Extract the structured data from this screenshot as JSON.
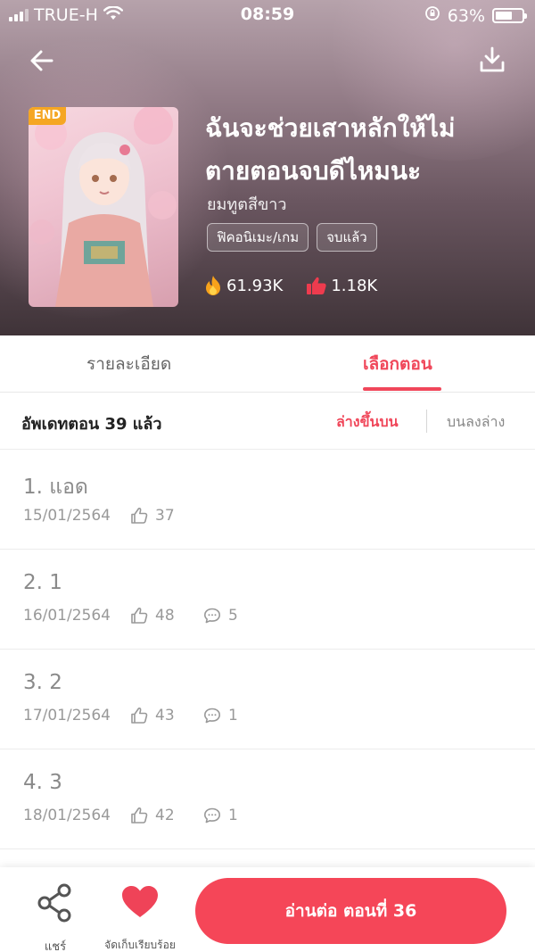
{
  "status_bar": {
    "carrier": "TRUE-H",
    "time": "08:59",
    "battery": "63%",
    "battery_level": 0.63,
    "wifi_icon": "wifi-icon",
    "lock_icon": "orientation-lock-icon"
  },
  "header": {
    "back_icon": "back-arrow-icon",
    "download_icon": "download-icon"
  },
  "book": {
    "badge": "END",
    "title_line1": "ฉันจะช่วยเสาหลักให้ไม่",
    "title_line2": "ตายตอนจบดีไหมนะ",
    "author": "ยมทูตสีขาว",
    "tags": [
      "ฟิคอนิเมะ/เกม",
      "จบแล้ว"
    ],
    "views": "61.93K",
    "likes": "1.18K",
    "views_icon": "fire-icon",
    "likes_icon": "thumbs-up-icon"
  },
  "tabs": [
    {
      "label": "รายละเอียด",
      "active": false
    },
    {
      "label": "เลือกตอน",
      "active": true
    }
  ],
  "episode_header": {
    "update_text": "อัพเดทตอน 39 แล้ว",
    "sort_asc": "ล่างขึ้นบน",
    "sort_desc": "บนลงล่าง"
  },
  "episodes": [
    {
      "title": "1. แอด",
      "date": "15/01/2564",
      "likes": "37",
      "comments": ""
    },
    {
      "title": "2. 1",
      "date": "16/01/2564",
      "likes": "48",
      "comments": "5"
    },
    {
      "title": "3. 2",
      "date": "17/01/2564",
      "likes": "43",
      "comments": "1"
    },
    {
      "title": "4. 3",
      "date": "18/01/2564",
      "likes": "42",
      "comments": "1"
    }
  ],
  "bottom_bar": {
    "share_label": "แชร์",
    "library_label": "จัดเก็บเรียบร้อย",
    "read_button": "อ่านต่อ ตอนที่ 36"
  },
  "colors": {
    "accent": "#f0475a",
    "read_button": "#f54658",
    "badge": "#f5a623"
  }
}
